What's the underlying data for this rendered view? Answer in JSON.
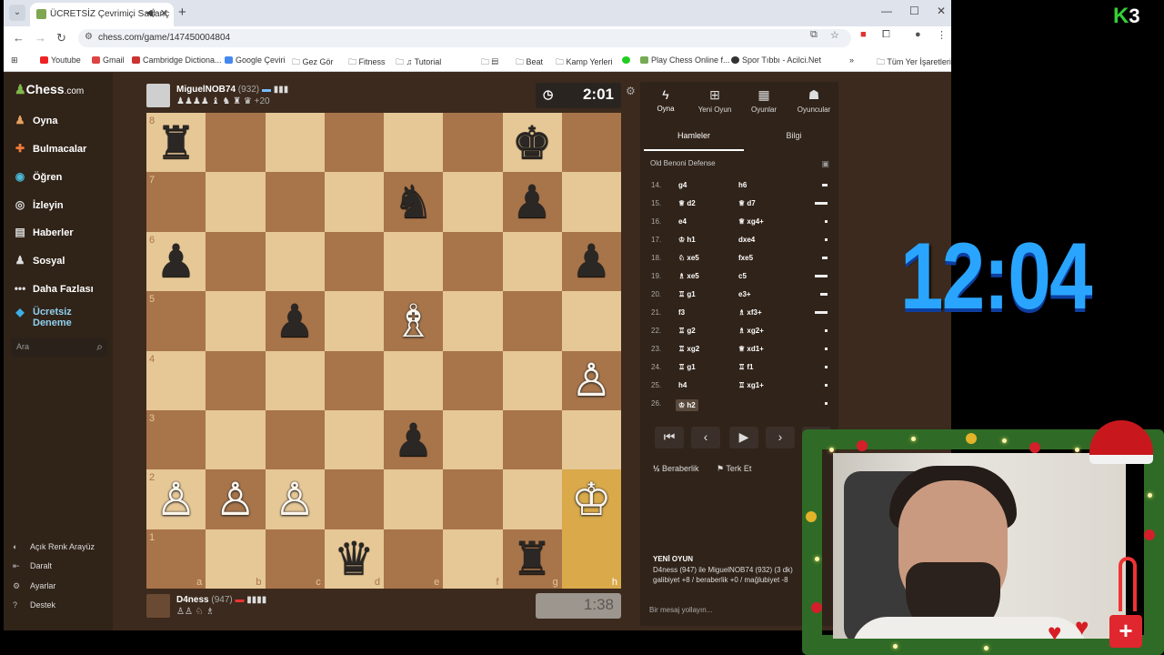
{
  "browser": {
    "tab_title": "ÜCRETSİZ Çevrimiçi Satranç",
    "url": "chess.com/game/147450004804",
    "bookmarks": [
      "Youtube",
      "Gmail",
      "Cambridge Dictiona...",
      "Google Çeviri",
      "Gez Gör",
      "Fitness",
      "Tutorial",
      "Beat",
      "Kamp Yerleri",
      "Play Chess Online f...",
      "Spor Tıbbı - Acilci.Net",
      "Tüm Yer İşaretleri"
    ]
  },
  "sidebar": {
    "logo": "Chess",
    "logo_suffix": ".com",
    "items": [
      {
        "label": "Oyna",
        "icon": "pawn-icon"
      },
      {
        "label": "Bulmacalar",
        "icon": "puzzle-icon"
      },
      {
        "label": "Öğren",
        "icon": "learn-icon"
      },
      {
        "label": "İzleyin",
        "icon": "watch-icon"
      },
      {
        "label": "Haberler",
        "icon": "news-icon"
      },
      {
        "label": "Sosyal",
        "icon": "social-icon"
      },
      {
        "label": "Daha Fazlası",
        "icon": "more-icon"
      },
      {
        "label": "Ücretsiz Deneme",
        "icon": "diamond-icon"
      }
    ],
    "search_placeholder": "Ara",
    "footer": [
      "Açık Renk Arayüz",
      "Daralt",
      "Ayarlar",
      "Destek"
    ]
  },
  "top_player": {
    "name": "MiguelNOB74",
    "rating": "(932)",
    "captured": "♟♟♟♟ ♝ ♞ ♜ ♛",
    "material": "+20",
    "clock": "2:01"
  },
  "bottom_player": {
    "name": "D4ness",
    "rating": "(947)",
    "captured": "♙♙ ♘ ♗",
    "clock": "1:38"
  },
  "board": {
    "ranks": [
      "8",
      "7",
      "6",
      "5",
      "4",
      "3",
      "2",
      "1"
    ],
    "files": [
      "a",
      "b",
      "c",
      "d",
      "e",
      "f",
      "g",
      "h"
    ],
    "pieces": [
      {
        "sq": "a8",
        "glyph": "♜",
        "color": "b"
      },
      {
        "sq": "g8",
        "glyph": "♚",
        "color": "b"
      },
      {
        "sq": "e7",
        "glyph": "♞",
        "color": "b"
      },
      {
        "sq": "g7",
        "glyph": "♟",
        "color": "b"
      },
      {
        "sq": "a6",
        "glyph": "♟",
        "color": "b"
      },
      {
        "sq": "h6",
        "glyph": "♟",
        "color": "b"
      },
      {
        "sq": "c5",
        "glyph": "♟",
        "color": "b"
      },
      {
        "sq": "e5",
        "glyph": "♗",
        "color": "w"
      },
      {
        "sq": "h4",
        "glyph": "♙",
        "color": "w"
      },
      {
        "sq": "e3",
        "glyph": "♟",
        "color": "b"
      },
      {
        "sq": "a2",
        "glyph": "♙",
        "color": "w"
      },
      {
        "sq": "b2",
        "glyph": "♙",
        "color": "w"
      },
      {
        "sq": "c2",
        "glyph": "♙",
        "color": "w"
      },
      {
        "sq": "h2",
        "glyph": "♔",
        "color": "w"
      },
      {
        "sq": "d1",
        "glyph": "♛",
        "color": "b"
      },
      {
        "sq": "g1",
        "glyph": "♜",
        "color": "b"
      }
    ],
    "highlights": [
      "h2",
      "h1"
    ]
  },
  "panel": {
    "tabs": [
      "Oyna",
      "Yeni Oyun",
      "Oyunlar",
      "Oyuncular"
    ],
    "subtabs": [
      "Hamleler",
      "Bilgi"
    ],
    "opening": "Old Benoni Defense",
    "moves": [
      {
        "n": "14.",
        "w": "g4",
        "b": "h6"
      },
      {
        "n": "15.",
        "w": "♕ d2",
        "b": "♕ d7"
      },
      {
        "n": "16.",
        "w": "e4",
        "b": "♕ xg4+"
      },
      {
        "n": "17.",
        "w": "♔ h1",
        "b": "dxe4"
      },
      {
        "n": "18.",
        "w": "♘ xe5",
        "b": "fxe5"
      },
      {
        "n": "19.",
        "w": "♗ xe5",
        "b": "c5"
      },
      {
        "n": "20.",
        "w": "♖ g1",
        "b": "e3+"
      },
      {
        "n": "21.",
        "w": "f3",
        "b": "♗ xf3+"
      },
      {
        "n": "22.",
        "w": "♖ g2",
        "b": "♗ xg2+"
      },
      {
        "n": "23.",
        "w": "♖ xg2",
        "b": "♕ xd1+"
      },
      {
        "n": "24.",
        "w": "♖ g1",
        "b": "♖ f1"
      },
      {
        "n": "25.",
        "w": "h4",
        "b": "♖ xg1+"
      },
      {
        "n": "26.",
        "w": "♔ h2",
        "b": ""
      }
    ],
    "draw_label": "Beraberlik",
    "resign_label": "Terk Et",
    "draw_icon": "½",
    "new_game_title": "YENİ OYUN",
    "new_game_line1": "D4ness (947) ile MiguelNOB74 (932) (3 dk)",
    "new_game_line2": "galibiyet +8 / beraberlik +0 / mağlubiyet -8",
    "message_placeholder": "Bir mesaj yollayın..."
  },
  "overlay": {
    "timer": "12:04",
    "brand_k": "K",
    "brand_num": "3"
  },
  "colors": {
    "light_square": "#e6c796",
    "dark_square": "#a8744a",
    "highlight": "#d9a94a",
    "timer_blue": "#2aa5ff"
  }
}
